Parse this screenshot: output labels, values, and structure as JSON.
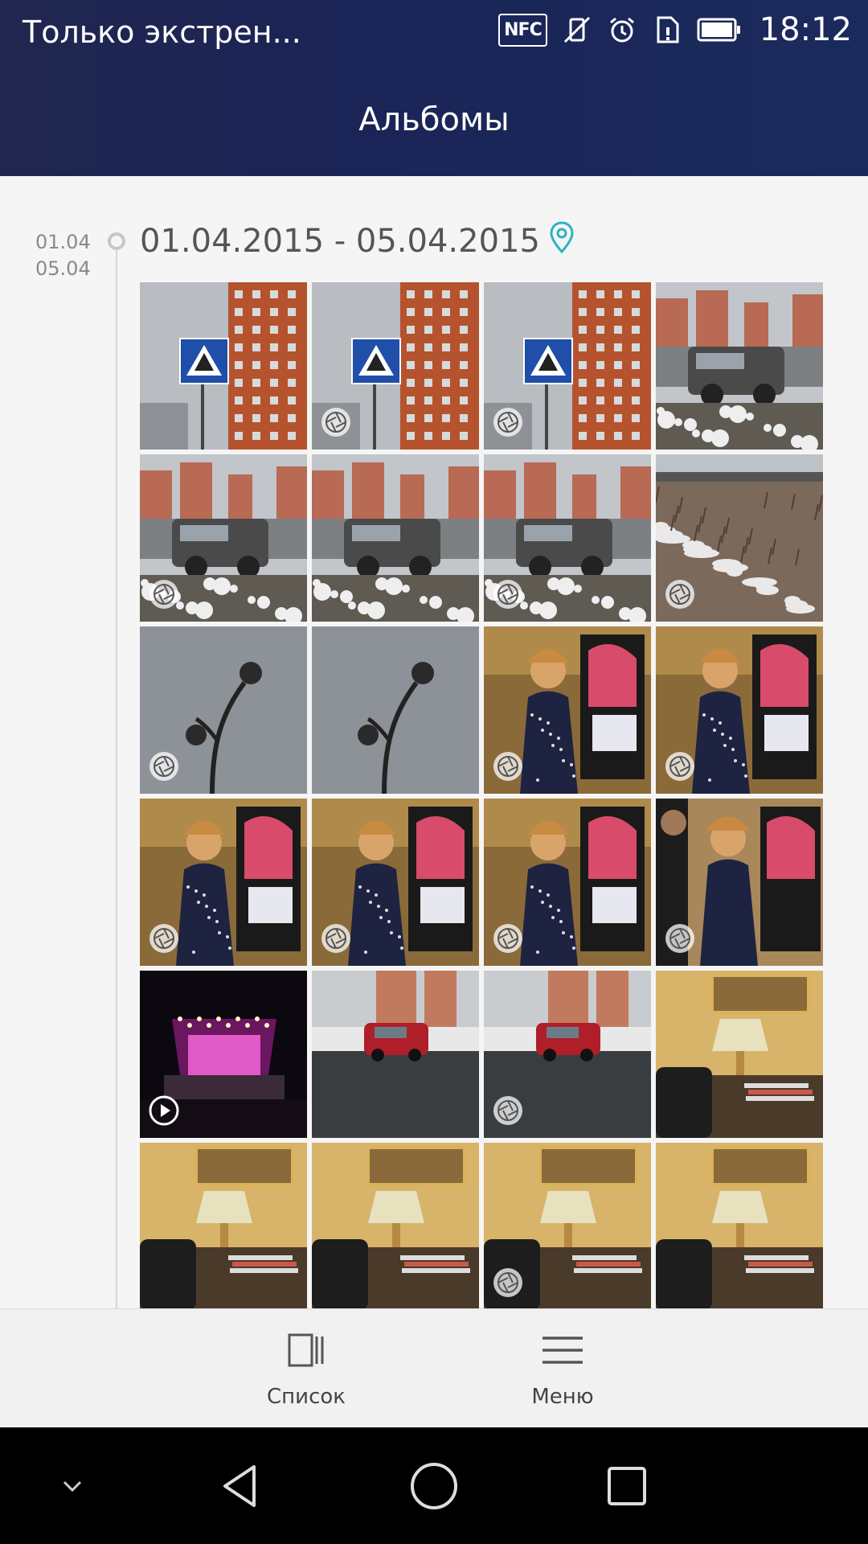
{
  "status_bar": {
    "text": "Только экстрен...",
    "nfc_label": "NFC",
    "time": "18:12",
    "icons": [
      "nfc-icon",
      "vibrate-off-icon",
      "alarm-icon",
      "sim-icon",
      "battery-icon"
    ]
  },
  "header": {
    "title": "Альбомы"
  },
  "album_group": {
    "side_date_start": "01.04",
    "side_date_end": "05.04",
    "title": "01.04.2015 - 05.04.2015",
    "thumbnails": [
      {
        "scene": "sign-building",
        "badge": "none"
      },
      {
        "scene": "sign-building",
        "badge": "aperture-icon"
      },
      {
        "scene": "sign-building",
        "badge": "aperture-icon"
      },
      {
        "scene": "car-buildings",
        "badge": "none"
      },
      {
        "scene": "car-buildings",
        "badge": "aperture-icon"
      },
      {
        "scene": "car-buildings",
        "badge": "none"
      },
      {
        "scene": "car-buildings",
        "badge": "aperture-icon"
      },
      {
        "scene": "snow-field",
        "badge": "aperture-icon"
      },
      {
        "scene": "street-lamp",
        "badge": "aperture-icon"
      },
      {
        "scene": "street-lamp",
        "badge": "none"
      },
      {
        "scene": "woman-poster",
        "badge": "aperture-icon"
      },
      {
        "scene": "woman-poster",
        "badge": "aperture-icon"
      },
      {
        "scene": "woman-poster",
        "badge": "aperture-icon"
      },
      {
        "scene": "woman-poster",
        "badge": "aperture-icon"
      },
      {
        "scene": "woman-poster",
        "badge": "aperture-icon"
      },
      {
        "scene": "woman-poster-man",
        "badge": "aperture-icon"
      },
      {
        "scene": "concert-stage",
        "badge": "play-icon"
      },
      {
        "scene": "red-car",
        "badge": "none"
      },
      {
        "scene": "red-car",
        "badge": "aperture-icon"
      },
      {
        "scene": "lamp-room",
        "badge": "none"
      },
      {
        "scene": "lamp-room",
        "badge": "none"
      },
      {
        "scene": "lamp-room",
        "badge": "none"
      },
      {
        "scene": "lamp-room",
        "badge": "aperture-icon"
      },
      {
        "scene": "lamp-room",
        "badge": "none"
      }
    ]
  },
  "bottom_bar": {
    "list_label": "Список",
    "menu_label": "Меню"
  },
  "nav_bar": {
    "buttons": [
      "chevron-down-icon",
      "back-icon",
      "home-icon",
      "recents-icon"
    ]
  },
  "colors": {
    "header_bg": "#1b2456",
    "accent_location": "#2bb3c0",
    "nav_bg": "#000000"
  }
}
